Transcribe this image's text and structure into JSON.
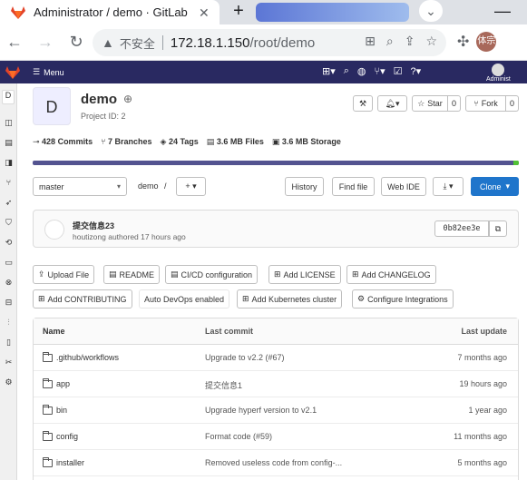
{
  "browser": {
    "tab_title": "Administrator / demo · GitLab",
    "tab_close": "✕",
    "new_tab": "+",
    "url_warning": "不安全",
    "url_host": "172.18.1.150",
    "url_path": "/root/demo",
    "profile": "体宗"
  },
  "gitlab_topbar": {
    "menu_label": "Menu",
    "user_label": "Administ"
  },
  "project": {
    "avatar_letter": "D",
    "name": "demo",
    "id_label": "Project ID: 2",
    "star_label": "Star",
    "star_count": "0",
    "fork_label": "Fork",
    "fork_count": "0",
    "stats": {
      "commits": "428 Commits",
      "branches": "7 Branches",
      "tags": "24 Tags",
      "files": "3.6 MB Files",
      "storage": "3.6 MB Storage"
    }
  },
  "repo_nav": {
    "branch": "master",
    "breadcrumb": "demo",
    "breadcrumb_sep": "/",
    "history": "History",
    "find_file": "Find file",
    "web_ide": "Web IDE",
    "clone": "Clone"
  },
  "last_commit": {
    "title": "提交信息23",
    "meta": "houtizong authored 17 hours ago",
    "sha": "0b82ee3e"
  },
  "quick_actions": {
    "upload": "Upload File",
    "readme": "README",
    "cicd": "CI/CD configuration",
    "license": "Add LICENSE",
    "changelog": "Add CHANGELOG",
    "contributing": "Add CONTRIBUTING",
    "autodevops": "Auto DevOps enabled",
    "kubernetes": "Add Kubernetes cluster",
    "integrations": "Configure Integrations"
  },
  "file_table": {
    "headers": {
      "name": "Name",
      "commit": "Last commit",
      "update": "Last update"
    },
    "rows": [
      {
        "name": ".github/workflows",
        "commit": "Upgrade to v2.2 (#67)",
        "update": "7 months ago"
      },
      {
        "name": "app",
        "commit": "提交信息1",
        "update": "19 hours ago"
      },
      {
        "name": "bin",
        "commit": "Upgrade hyperf version to v2.1",
        "update": "1 year ago"
      },
      {
        "name": "config",
        "commit": "Format code (#59)",
        "update": "11 months ago"
      },
      {
        "name": "installer",
        "commit": "Removed useless code from config-...",
        "update": "5 months ago"
      }
    ]
  },
  "colors": {
    "topbar": "#292961",
    "clone_button": "#1f75cb",
    "language_bar": "#535390",
    "language_bar_accent": "#52c236"
  }
}
